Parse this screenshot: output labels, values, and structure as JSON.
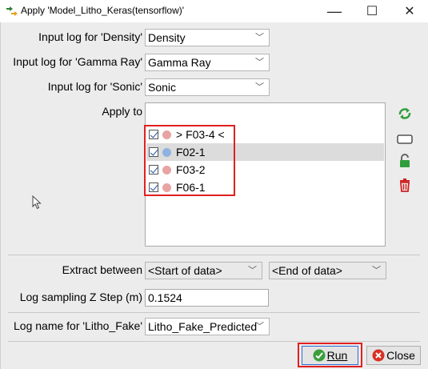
{
  "window": {
    "title": "Apply 'Model_Litho_Keras(tensorflow)'",
    "minimize": "—",
    "maximize": "☐",
    "close": "✕"
  },
  "inputs": {
    "density": {
      "label": "Input log for 'Density'",
      "value": "Density"
    },
    "gamma": {
      "label": "Input log for 'Gamma Ray'",
      "value": "Gamma Ray"
    },
    "sonic": {
      "label": "Input log for 'Sonic'",
      "value": "Sonic"
    }
  },
  "apply_to": {
    "label": "Apply to",
    "filter_value": "*",
    "wells": [
      {
        "name": "> F03-4 <",
        "checked": true,
        "selected": false,
        "dot_color": "#e8a3a3"
      },
      {
        "name": "F02-1",
        "checked": true,
        "selected": true,
        "dot_color": "#8fb3e0"
      },
      {
        "name": "F03-2",
        "checked": true,
        "selected": false,
        "dot_color": "#e8a3a3"
      },
      {
        "name": "F06-1",
        "checked": true,
        "selected": false,
        "dot_color": "#e8a3a3"
      }
    ]
  },
  "extract": {
    "label": "Extract between",
    "start": "<Start of data>",
    "end": "<End of data>"
  },
  "sampling": {
    "label": "Log sampling Z Step (m)",
    "value": "0.1524"
  },
  "output": {
    "label": "Log name for 'Litho_Fake'",
    "value": "Litho_Fake_Predicted"
  },
  "buttons": {
    "run": "Run",
    "close": "Close"
  },
  "colors": {
    "highlight_red": "#e02020",
    "run_focus": "#2b6cd6"
  }
}
